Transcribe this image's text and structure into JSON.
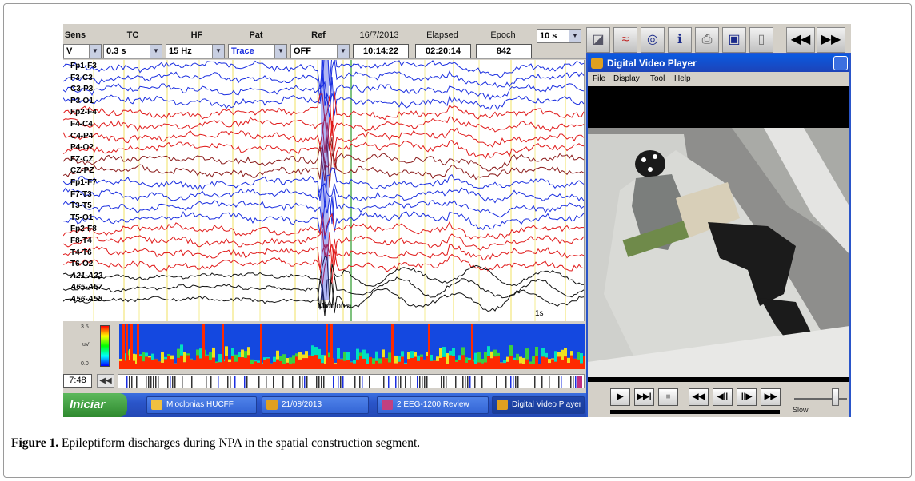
{
  "toolbar": {
    "labels": {
      "sens": "Sens",
      "tc": "TC",
      "hf": "HF",
      "pat": "Pat",
      "ref": "Ref"
    },
    "selects": {
      "sens": "V",
      "tc": "0.3 s",
      "hf": "15 Hz",
      "pat": "Trace",
      "ref": "OFF"
    },
    "date": "16/7/2013",
    "elapsed_label": "Elapsed",
    "epoch_label": "Epoch",
    "time": "10:14:22",
    "elapsed": "02:20:14",
    "epoch": "842",
    "window": "10 s",
    "icons": [
      "montage-icon",
      "scale-icon",
      "grid-icon",
      "info-icon",
      "print-icon",
      "photo-icon",
      "book-icon",
      "rewind-icon",
      "forward-icon"
    ]
  },
  "channels": [
    {
      "label": "Fp1-F3",
      "color": "#1a2ee0"
    },
    {
      "label": "F3-C3",
      "color": "#1a2ee0"
    },
    {
      "label": "C3-P3",
      "color": "#1a2ee0"
    },
    {
      "label": "P3-O1",
      "color": "#1a2ee0"
    },
    {
      "label": "Fp2-F4",
      "color": "#e01a1a"
    },
    {
      "label": "F4-C4",
      "color": "#e01a1a"
    },
    {
      "label": "C4-P4",
      "color": "#e01a1a"
    },
    {
      "label": "P4-O2",
      "color": "#e01a1a"
    },
    {
      "label": "FZ-CZ",
      "color": "#8a1a1a"
    },
    {
      "label": "CZ-PZ",
      "color": "#8a1a1a"
    },
    {
      "label": "Fp1-F7",
      "color": "#1a2ee0"
    },
    {
      "label": "F7-T3",
      "color": "#1a2ee0"
    },
    {
      "label": "T3-T5",
      "color": "#1a2ee0"
    },
    {
      "label": "T5-O1",
      "color": "#1a2ee0"
    },
    {
      "label": "Fp2-F8",
      "color": "#e01a1a"
    },
    {
      "label": "F8-T4",
      "color": "#e01a1a"
    },
    {
      "label": "T4-T6",
      "color": "#e01a1a"
    },
    {
      "label": "T6-O2",
      "color": "#e01a1a"
    },
    {
      "label": "A21-A22",
      "color": "#111111"
    },
    {
      "label": "A65-A57",
      "color": "#111111"
    },
    {
      "label": "A56-A58",
      "color": "#111111"
    }
  ],
  "annotations": {
    "event": "Mioclonia",
    "scale": "1s"
  },
  "spectrogram": {
    "scale_top": "3.5",
    "scale_mid": "uV",
    "scale_bottom": "0.0"
  },
  "timeline": {
    "time": "7:48",
    "prev": "◀◀"
  },
  "taskbar": {
    "start": "Iniciar",
    "tasks": [
      "Mioclonias HUCFF",
      "21/08/2013",
      "2 EEG-1200 Review",
      "Digital Video Player"
    ]
  },
  "video_player": {
    "title": "Digital Video Player",
    "menu": [
      "File",
      "Display",
      "Tool",
      "Help"
    ],
    "controls": [
      "▶",
      "▶▶|",
      "■",
      "◀◀",
      "◀||",
      "||▶",
      "▶▶"
    ],
    "speed_label": "Slow"
  },
  "caption": {
    "label": "Figure 1.",
    "text": " Epileptiform discharges during NPA in the spatial construction segment."
  }
}
